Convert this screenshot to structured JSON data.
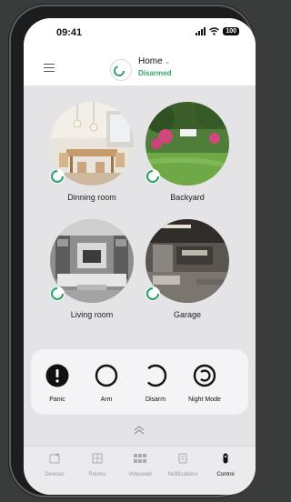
{
  "status_bar": {
    "time": "09:41",
    "battery": "100"
  },
  "header": {
    "title": "Home",
    "status": "Disarmed"
  },
  "rooms": [
    {
      "label": "Dinning room"
    },
    {
      "label": "Backyard"
    },
    {
      "label": "Living room"
    },
    {
      "label": "Garage"
    }
  ],
  "controls": [
    {
      "label": "Panic"
    },
    {
      "label": "Arm"
    },
    {
      "label": "Disarm"
    },
    {
      "label": "Night Mode"
    }
  ],
  "tabs": [
    {
      "label": "Devices"
    },
    {
      "label": "Rooms"
    },
    {
      "label": "Videowall"
    },
    {
      "label": "Notifications"
    },
    {
      "label": "Control",
      "active": true
    }
  ],
  "colors": {
    "accent_green": "#2fa56a",
    "background": "#e4e4e6"
  },
  "icons": [
    "menu-icon",
    "hub-icon",
    "chevron-down-icon",
    "panic-icon",
    "arm-icon",
    "disarm-icon",
    "night-mode-icon",
    "chevron-up-icon",
    "devices-icon",
    "rooms-icon",
    "videowall-icon",
    "notifications-icon",
    "control-icon"
  ]
}
